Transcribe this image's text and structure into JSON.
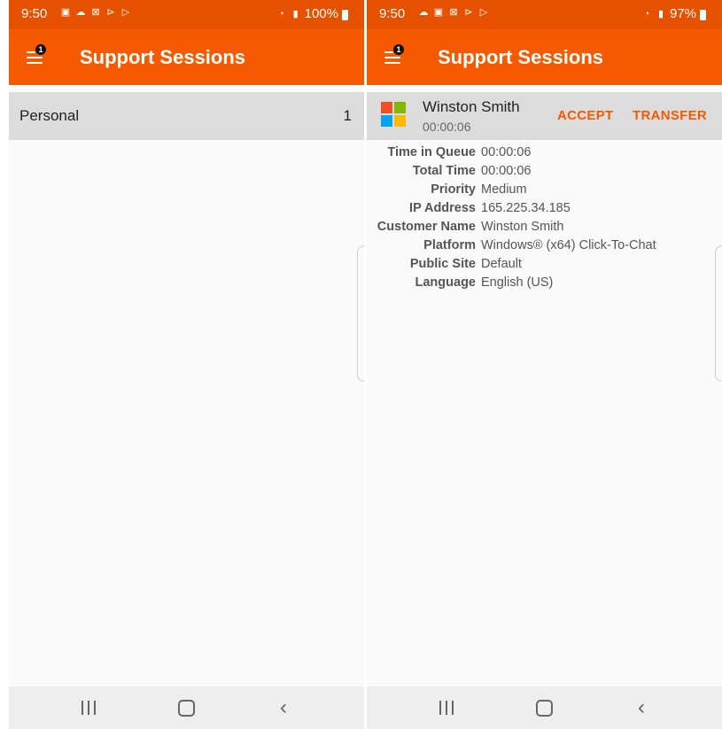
{
  "left": {
    "status": {
      "time": "9:50",
      "battery": "100%"
    },
    "appbar": {
      "title": "Support Sessions",
      "menu_badge": "1"
    },
    "group": {
      "label": "Personal",
      "count": "1"
    }
  },
  "right": {
    "status": {
      "time": "9:50",
      "battery": "97%"
    },
    "appbar": {
      "title": "Support Sessions",
      "menu_badge": "1"
    },
    "session": {
      "name": "Winston Smith",
      "elapsed": "00:00:06",
      "accept_label": "ACCEPT",
      "transfer_label": "TRANSFER"
    },
    "details": [
      {
        "label": "Time in Queue",
        "value": "00:00:06"
      },
      {
        "label": "Total Time",
        "value": "00:00:06"
      },
      {
        "label": "Priority",
        "value": "Medium"
      },
      {
        "label": "IP Address",
        "value": "165.225.34.185"
      },
      {
        "label": "Customer Name",
        "value": "Winston Smith"
      },
      {
        "label": "Platform",
        "value": "Windows® (x64) Click-To-Chat"
      },
      {
        "label": "Public Site",
        "value": "Default"
      },
      {
        "label": "Language",
        "value": "English (US)"
      }
    ]
  },
  "icons": {
    "status_left": [
      "image-icon",
      "cloud-icon",
      "close-box-icon",
      "play-store-icon",
      "play-icon"
    ],
    "status_right": [
      "wifi-icon",
      "signal-icon",
      "battery-icon"
    ],
    "menu": "menu-icon",
    "session_platform": "windows-logo-icon",
    "nav": [
      "recents-icon",
      "home-icon",
      "back-icon"
    ]
  },
  "colors": {
    "status_bar": "#e65100",
    "app_bar": "#f55a00",
    "accent": "#f55a00",
    "row_bg": "#dcdcdc",
    "windows_logo": [
      "#f25022",
      "#7fba00",
      "#00a4ef",
      "#ffb900"
    ]
  }
}
